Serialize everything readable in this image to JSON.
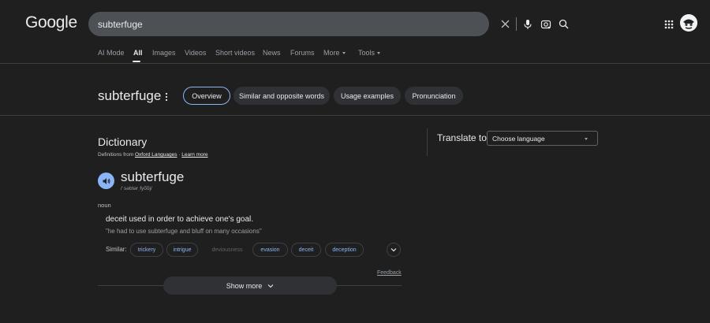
{
  "header": {
    "logo": "Google",
    "search_value": "subterfuge",
    "icons": [
      "clear-icon",
      "microphone-icon",
      "lens-icon",
      "search-icon",
      "apps-grid-icon",
      "avatar"
    ]
  },
  "tabs": {
    "ai_mode": "AI Mode",
    "all": "All",
    "images": "Images",
    "videos": "Videos",
    "short_videos": "Short videos",
    "news": "News",
    "forums": "Forums",
    "more": "More",
    "tools": "Tools"
  },
  "word_header": {
    "word": "subterfuge",
    "pills": {
      "overview": "Overview",
      "similar": "Similar and opposite words",
      "usage": "Usage examples",
      "pronunciation": "Pronunciation"
    }
  },
  "dictionary": {
    "title": "Dictionary",
    "defs_from_prefix": "Definitions from",
    "source": "Oxford Languages",
    "separator": "·",
    "learn_more": "Learn more",
    "headword": "subterfuge",
    "phonetic": "/ˈsəbtərˌfyo͞oj/",
    "part_of_speech": "noun",
    "definition": "deceit used in order to achieve one's goal.",
    "example": "\"he had to use subterfuge and bluff on many occasions\"",
    "similar_label": "Similar:",
    "similar": {
      "trickery": "trickery",
      "intrigue": "intrigue",
      "deviousness": "deviousness",
      "evasion": "evasion",
      "deceit": "deceit",
      "deception": "deception"
    },
    "feedback": "Feedback",
    "show_more": "Show more"
  },
  "translate": {
    "label": "Translate to",
    "select_value": "Choose language"
  },
  "colors": {
    "background": "#1f1f1f",
    "accent": "#8ab4f8",
    "surface": "#303134",
    "text": "#e8eaed"
  }
}
